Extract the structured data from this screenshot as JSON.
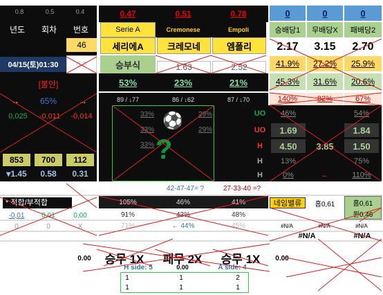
{
  "header": {
    "top_small": [
      "0.8",
      "0.5",
      "0.4"
    ],
    "labels": [
      "년도",
      "회차",
      "번호"
    ],
    "number": "46",
    "datetime": "04/15(토)01:30",
    "cell_x": "0.0"
  },
  "odds_top": [
    "0.47",
    "0.51",
    "0.78"
  ],
  "teams_en": [
    "Serie A",
    "Cremonese",
    "Empoli"
  ],
  "teams_ko": [
    "세리에A",
    "크레모네",
    "엠폴리"
  ],
  "result_label": "승부식",
  "faded_pair": [
    "1.63",
    "2.52"
  ],
  "pcts_main": [
    "53%",
    "23%",
    "21%"
  ],
  "blue_headers": [
    "0",
    "0",
    "0"
  ],
  "green_headers": [
    "승배당1",
    "무배당X",
    "패배당2"
  ],
  "odds": [
    "2.17",
    "3.15",
    "2.70"
  ],
  "odds_pct_a": [
    "41.9%",
    "27.2%",
    "25.9%"
  ],
  "odds_pct_b": [
    "45.3%",
    "31.6%",
    "20.6%"
  ],
  "odds_pct_c": [
    "140%",
    "82%",
    "67%"
  ],
  "left_block": {
    "unsafe": "[불안]",
    "arrow": "→",
    "pct": "65%",
    "changes": [
      "0,025",
      "-0,011",
      "-0,014"
    ],
    "nums": [
      "853",
      "700",
      "112"
    ],
    "decimals": [
      "▾1.45",
      "0.58",
      "0.31"
    ]
  },
  "arrows_row": [
    "89 / ↓77",
    "86 / ↓62",
    "87 / ↓70"
  ],
  "pitch": {
    "left_pcts": [
      "33%",
      "33%",
      "33%"
    ],
    "right_pcts": [
      "29%",
      "29%"
    ],
    "question": "?",
    "ball": "⚽"
  },
  "right_rows": {
    "labels": [
      "UO",
      "UO",
      "H",
      "H",
      "H"
    ],
    "uo1": [
      "46%",
      "",
      "54%"
    ],
    "uo2": [
      "1.69",
      "",
      "1.84"
    ],
    "h1": [
      "4.50",
      "3.85",
      "1.50"
    ],
    "h2": [
      "13%",
      "",
      "75%"
    ],
    "h3": [
      "0%",
      "←",
      "110%"
    ]
  },
  "formula_line": [
    "42-47-47= ?",
    "27-33-40 =?"
  ],
  "fit_label": "* 적합/부적합",
  "fit_rows": [
    [
      "-0,01",
      "0,01",
      "0,00"
    ],
    [
      "0",
      "0",
      "X"
    ]
  ],
  "mid_pcts": [
    [
      "105%",
      "46%",
      "41%"
    ],
    [
      "91%",
      "43%",
      "48%"
    ],
    [
      "71%",
      "← 44%",
      "45%"
    ]
  ],
  "name_value": "네임밸류",
  "home_val": "홈0,61",
  "home_val2": "홈0,61",
  "away_val": "원0,46",
  "na": "#N/A",
  "bottom": {
    "zero": "0.00",
    "labels": [
      "승무 1X",
      "패무 2X",
      "승무 1X"
    ],
    "sides": [
      "H side: 5",
      "0.00",
      "A side: 4"
    ],
    "zero_right": "0.00",
    "grid": [
      [
        "1",
        "1",
        "2"
      ],
      [
        "1",
        "1",
        "1"
      ]
    ]
  }
}
